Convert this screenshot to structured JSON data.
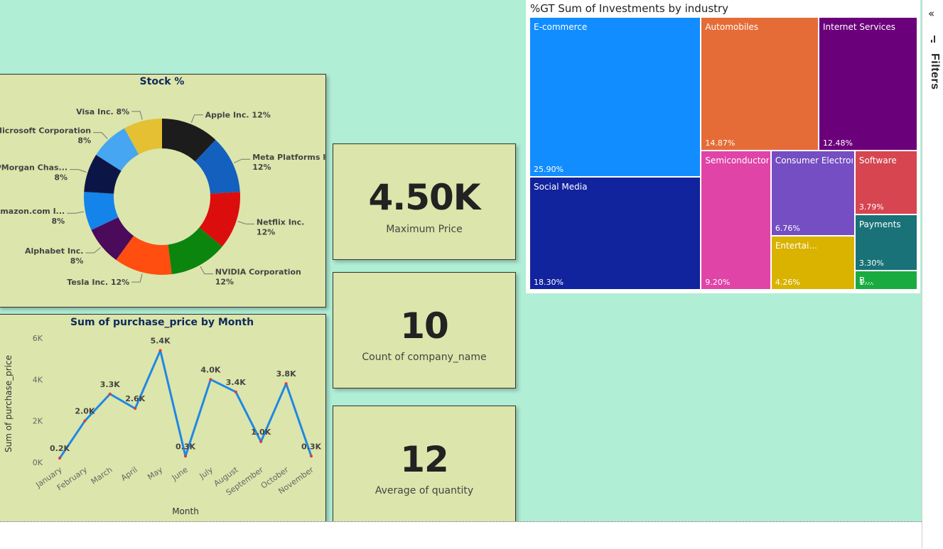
{
  "filters_pane": {
    "collapse_glyph": "«",
    "label": "Filters",
    "icon": "filter-icon"
  },
  "kpis": [
    {
      "value": "4.50K",
      "label": "Maximum Price"
    },
    {
      "value": "10",
      "label": "Count of company_name"
    },
    {
      "value": "12",
      "label": "Average of quantity"
    }
  ],
  "chart_data": [
    {
      "type": "donut",
      "title": "Stock %",
      "slices": [
        {
          "label": "Apple Inc.",
          "percent": 12,
          "color": "#1c1c1c"
        },
        {
          "label": "Meta Platforms Inc.",
          "percent": 12,
          "color": "#1460be"
        },
        {
          "label": "Netflix Inc.",
          "percent": 12,
          "color": "#dc0d0d"
        },
        {
          "label": "NVIDIA Corporation",
          "percent": 12,
          "color": "#0b850d"
        },
        {
          "label": "Tesla Inc.",
          "percent": 12,
          "color": "#ff4e10"
        },
        {
          "label": "Alphabet Inc.",
          "percent": 8,
          "color": "#4c0a5b"
        },
        {
          "label": "Amazon.com I...",
          "percent": 8,
          "color": "#1483ea"
        },
        {
          "label": "JPMorgan Chas...",
          "percent": 8,
          "color": "#0c1646"
        },
        {
          "label": "Microsoft Corporation",
          "percent": 8,
          "color": "#46a6f2"
        },
        {
          "label": "Visa Inc.",
          "percent": 8,
          "color": "#e4c032"
        }
      ],
      "slice_labels": [
        {
          "line1": "Apple Inc. 12%",
          "line2": ""
        },
        {
          "line1": "Meta Platforms Inc.",
          "line2": "12%"
        },
        {
          "line1": "Netflix Inc.",
          "line2": "12%"
        },
        {
          "line1": "NVIDIA Corporation",
          "line2": "12%"
        },
        {
          "line1": "Tesla Inc. 12%",
          "line2": ""
        },
        {
          "line1": "Alphabet Inc.",
          "line2": "8%"
        },
        {
          "line1": "Amazon.com I...",
          "line2": "8%"
        },
        {
          "line1": "JPMorgan Chas...",
          "line2": "8%"
        },
        {
          "line1": "Microsoft Corporation",
          "line2": "8%"
        },
        {
          "line1": "Visa Inc. 8%",
          "line2": ""
        }
      ]
    },
    {
      "type": "line",
      "title": "Sum of purchase_price by Month",
      "xlabel": "Month",
      "ylabel": "Sum of purchase_price",
      "ylim": [
        0,
        6000
      ],
      "yticks": [
        0,
        2000,
        4000,
        6000
      ],
      "ytick_labels": [
        "0K",
        "2K",
        "4K",
        "6K"
      ],
      "categories": [
        "January",
        "February",
        "March",
        "April",
        "May",
        "June",
        "July",
        "August",
        "September",
        "October",
        "November"
      ],
      "values": [
        200,
        2000,
        3300,
        2600,
        5400,
        300,
        4000,
        3400,
        1000,
        3800,
        300
      ],
      "data_labels": [
        "0.2K",
        "2.0K",
        "3.3K",
        "2.6K",
        "5.4K",
        "0.3K",
        "4.0K",
        "3.4K",
        "1.0K",
        "3.8K",
        "0.3K"
      ],
      "line_color": "#1e88e5",
      "marker_color": "#e53935",
      "grid": false
    },
    {
      "type": "treemap",
      "title": "%GT Sum of Investments by industry",
      "items": [
        {
          "name": "E-commerce",
          "percent_label": "25.90%",
          "value": 25.9,
          "color": "#118dff"
        },
        {
          "name": "Social Media",
          "percent_label": "18.30%",
          "value": 18.3,
          "color": "#12239e"
        },
        {
          "name": "Automobiles",
          "percent_label": "14.87%",
          "value": 14.87,
          "color": "#e66c37"
        },
        {
          "name": "Internet Services",
          "percent_label": "12.48%",
          "value": 12.48,
          "color": "#6b007b"
        },
        {
          "name": "Semiconductors",
          "percent_label": "9.20%",
          "value": 9.2,
          "color": "#e044a7"
        },
        {
          "name": "Consumer Electronics",
          "percent_label": "6.76%",
          "value": 6.76,
          "color": "#744ec2"
        },
        {
          "name": "Entertai...",
          "percent_label": "4.26%",
          "value": 4.26,
          "color": "#d9b300"
        },
        {
          "name": "Software",
          "percent_label": "3.79%",
          "value": 3.79,
          "color": "#d64550"
        },
        {
          "name": "Payments",
          "percent_label": "3.30%",
          "value": 3.3,
          "color": "#197278"
        },
        {
          "name": "B...",
          "percent_label": "1....",
          "value": 1.14,
          "color": "#1aab40"
        }
      ]
    }
  ]
}
